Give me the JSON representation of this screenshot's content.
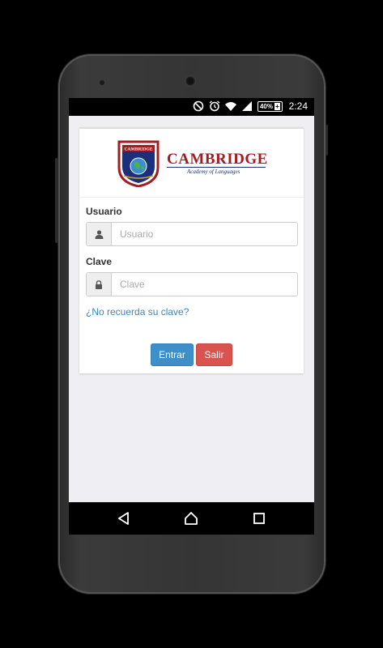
{
  "statusbar": {
    "battery_text": "40%",
    "battery_plus": "+",
    "time": "2:24",
    "icons": [
      "do-not-disturb-icon",
      "alarm-icon",
      "wifi-icon",
      "signal-icon",
      "battery-icon"
    ]
  },
  "logo": {
    "crest_text": "CAMBRIDGE",
    "brand": "CAMBRIDGE",
    "tagline": "Academy of Languages"
  },
  "form": {
    "user_label": "Usuario",
    "user_placeholder": "Usuario",
    "password_label": "Clave",
    "password_placeholder": "Clave",
    "forgot_link": "¿No recuerda su clave?",
    "enter_label": "Entrar",
    "exit_label": "Salir"
  },
  "colors": {
    "primary": "#3d8ec9",
    "danger": "#d9534f",
    "brand_red": "#a31c21",
    "brand_blue": "#1d2f7a",
    "link": "#3a87c6"
  },
  "navbar": {
    "icons": [
      "back-icon",
      "home-icon",
      "recents-icon"
    ]
  }
}
